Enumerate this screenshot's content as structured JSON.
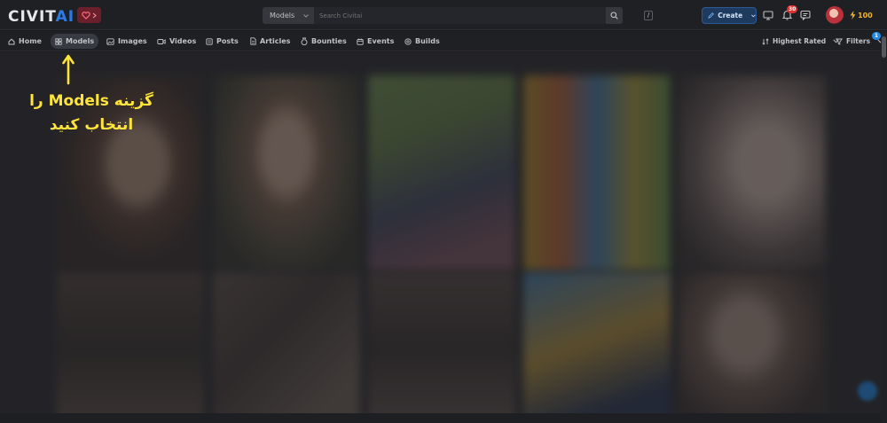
{
  "brand": {
    "logo_text_main": "CIVIT",
    "logo_text_accent": "AI"
  },
  "search": {
    "scope": "Models",
    "placeholder": "Search Civitai",
    "shortcut": "/"
  },
  "header": {
    "create_label": "Create",
    "notification_count": "30",
    "buzz_amount": "100"
  },
  "nav": {
    "items": [
      {
        "label": "Home",
        "icon": "home-icon"
      },
      {
        "label": "Models",
        "icon": "grid-icon",
        "active": true
      },
      {
        "label": "Images",
        "icon": "image-icon"
      },
      {
        "label": "Videos",
        "icon": "video-icon"
      },
      {
        "label": "Posts",
        "icon": "posts-icon"
      },
      {
        "label": "Articles",
        "icon": "article-icon"
      },
      {
        "label": "Bounties",
        "icon": "bounty-icon"
      },
      {
        "label": "Events",
        "icon": "calendar-icon"
      },
      {
        "label": "Builds",
        "icon": "builds-icon"
      }
    ],
    "sort_label": "Highest Rated",
    "filters_label": "Filters",
    "filters_count": "1"
  },
  "annotation": {
    "line1": "گزینه Models را",
    "line2": "انتخاب کنید"
  },
  "colors": {
    "accent": "#228be6",
    "annotation": "#ffe43a",
    "background": "#1a1b1e",
    "heart": "#6b1f2a"
  }
}
